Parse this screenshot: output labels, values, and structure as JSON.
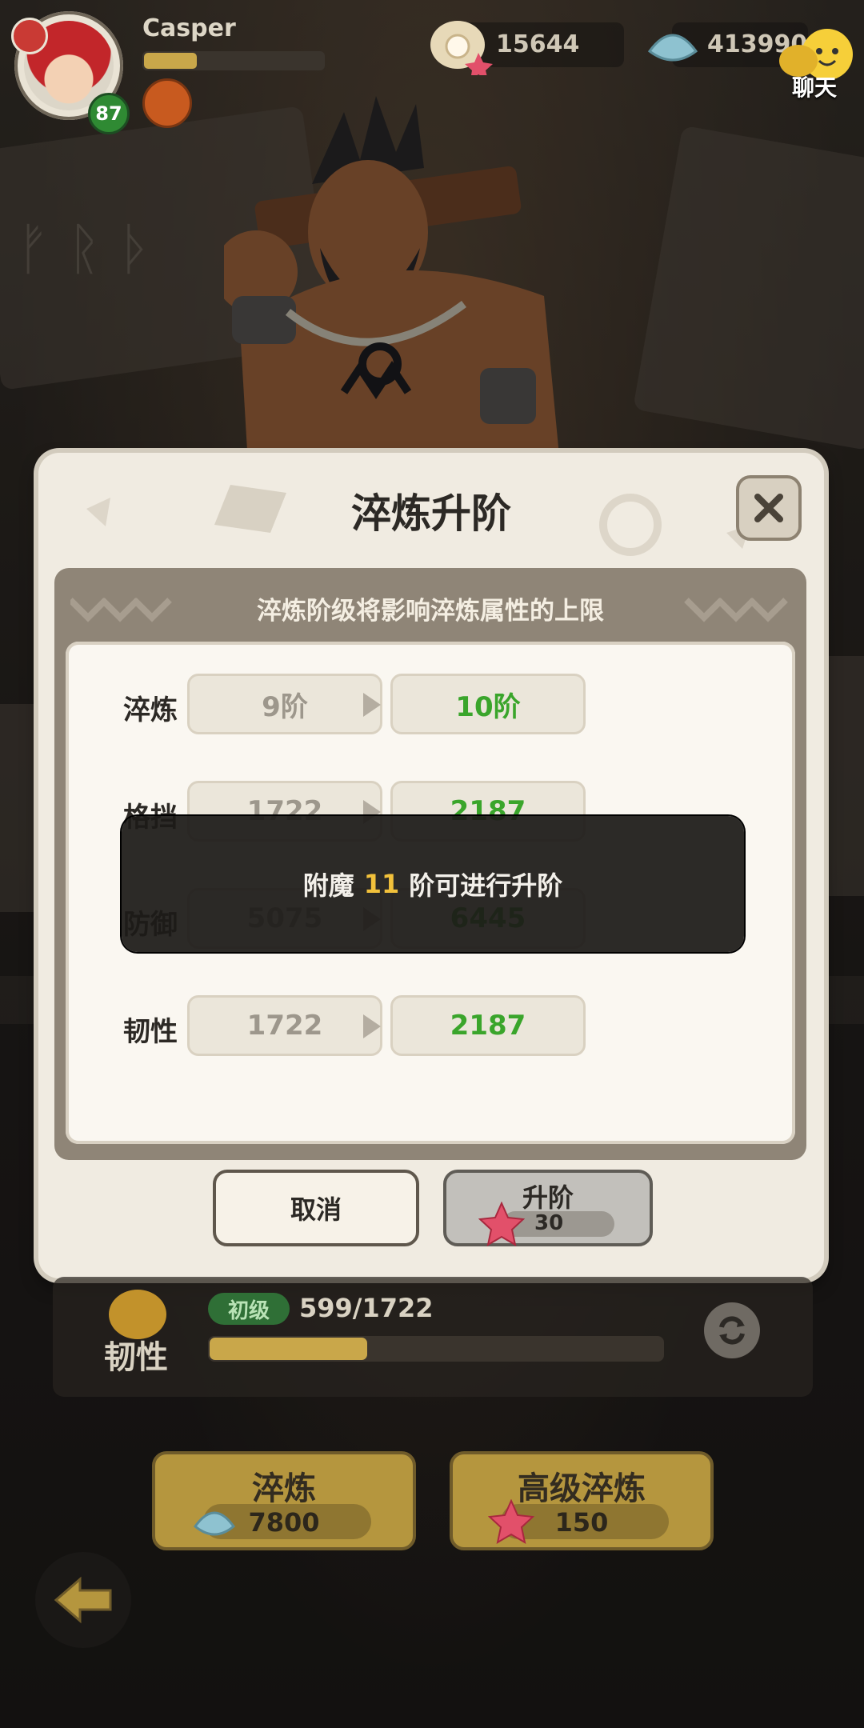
{
  "player": {
    "name": "Casper",
    "level": "87"
  },
  "currency": {
    "pearl": "15644",
    "shell": "413990"
  },
  "chat": {
    "label": "聊天"
  },
  "dialog": {
    "title": "淬炼升阶",
    "subtitle": "淬炼阶级将影响淬炼属性的上限",
    "rows": [
      {
        "label": "淬炼",
        "current": "9阶",
        "next": "10阶"
      },
      {
        "label": "格挡",
        "current": "1722",
        "next": "2187"
      },
      {
        "label": "防御",
        "current": "5075",
        "next": "6445"
      },
      {
        "label": "韧性",
        "current": "1722",
        "next": "2187"
      }
    ],
    "cancel_label": "取消",
    "upgrade_label": "升阶",
    "upgrade_cost": "30"
  },
  "toast": {
    "prefix": "附魔",
    "number": "11",
    "suffix": "阶可进行升阶"
  },
  "attribute": {
    "label": "韧性",
    "tier": "初级",
    "progress": "599/1722",
    "fill_fraction": 0.348
  },
  "actions": {
    "temper_label": "淬炼",
    "temper_cost": "7800",
    "adv_temper_label": "高级淬炼",
    "adv_temper_cost": "150"
  },
  "colors": {
    "accent_green": "#3aa52b",
    "toast_number": "#f2c13b",
    "gold_button": "#b5963e"
  }
}
